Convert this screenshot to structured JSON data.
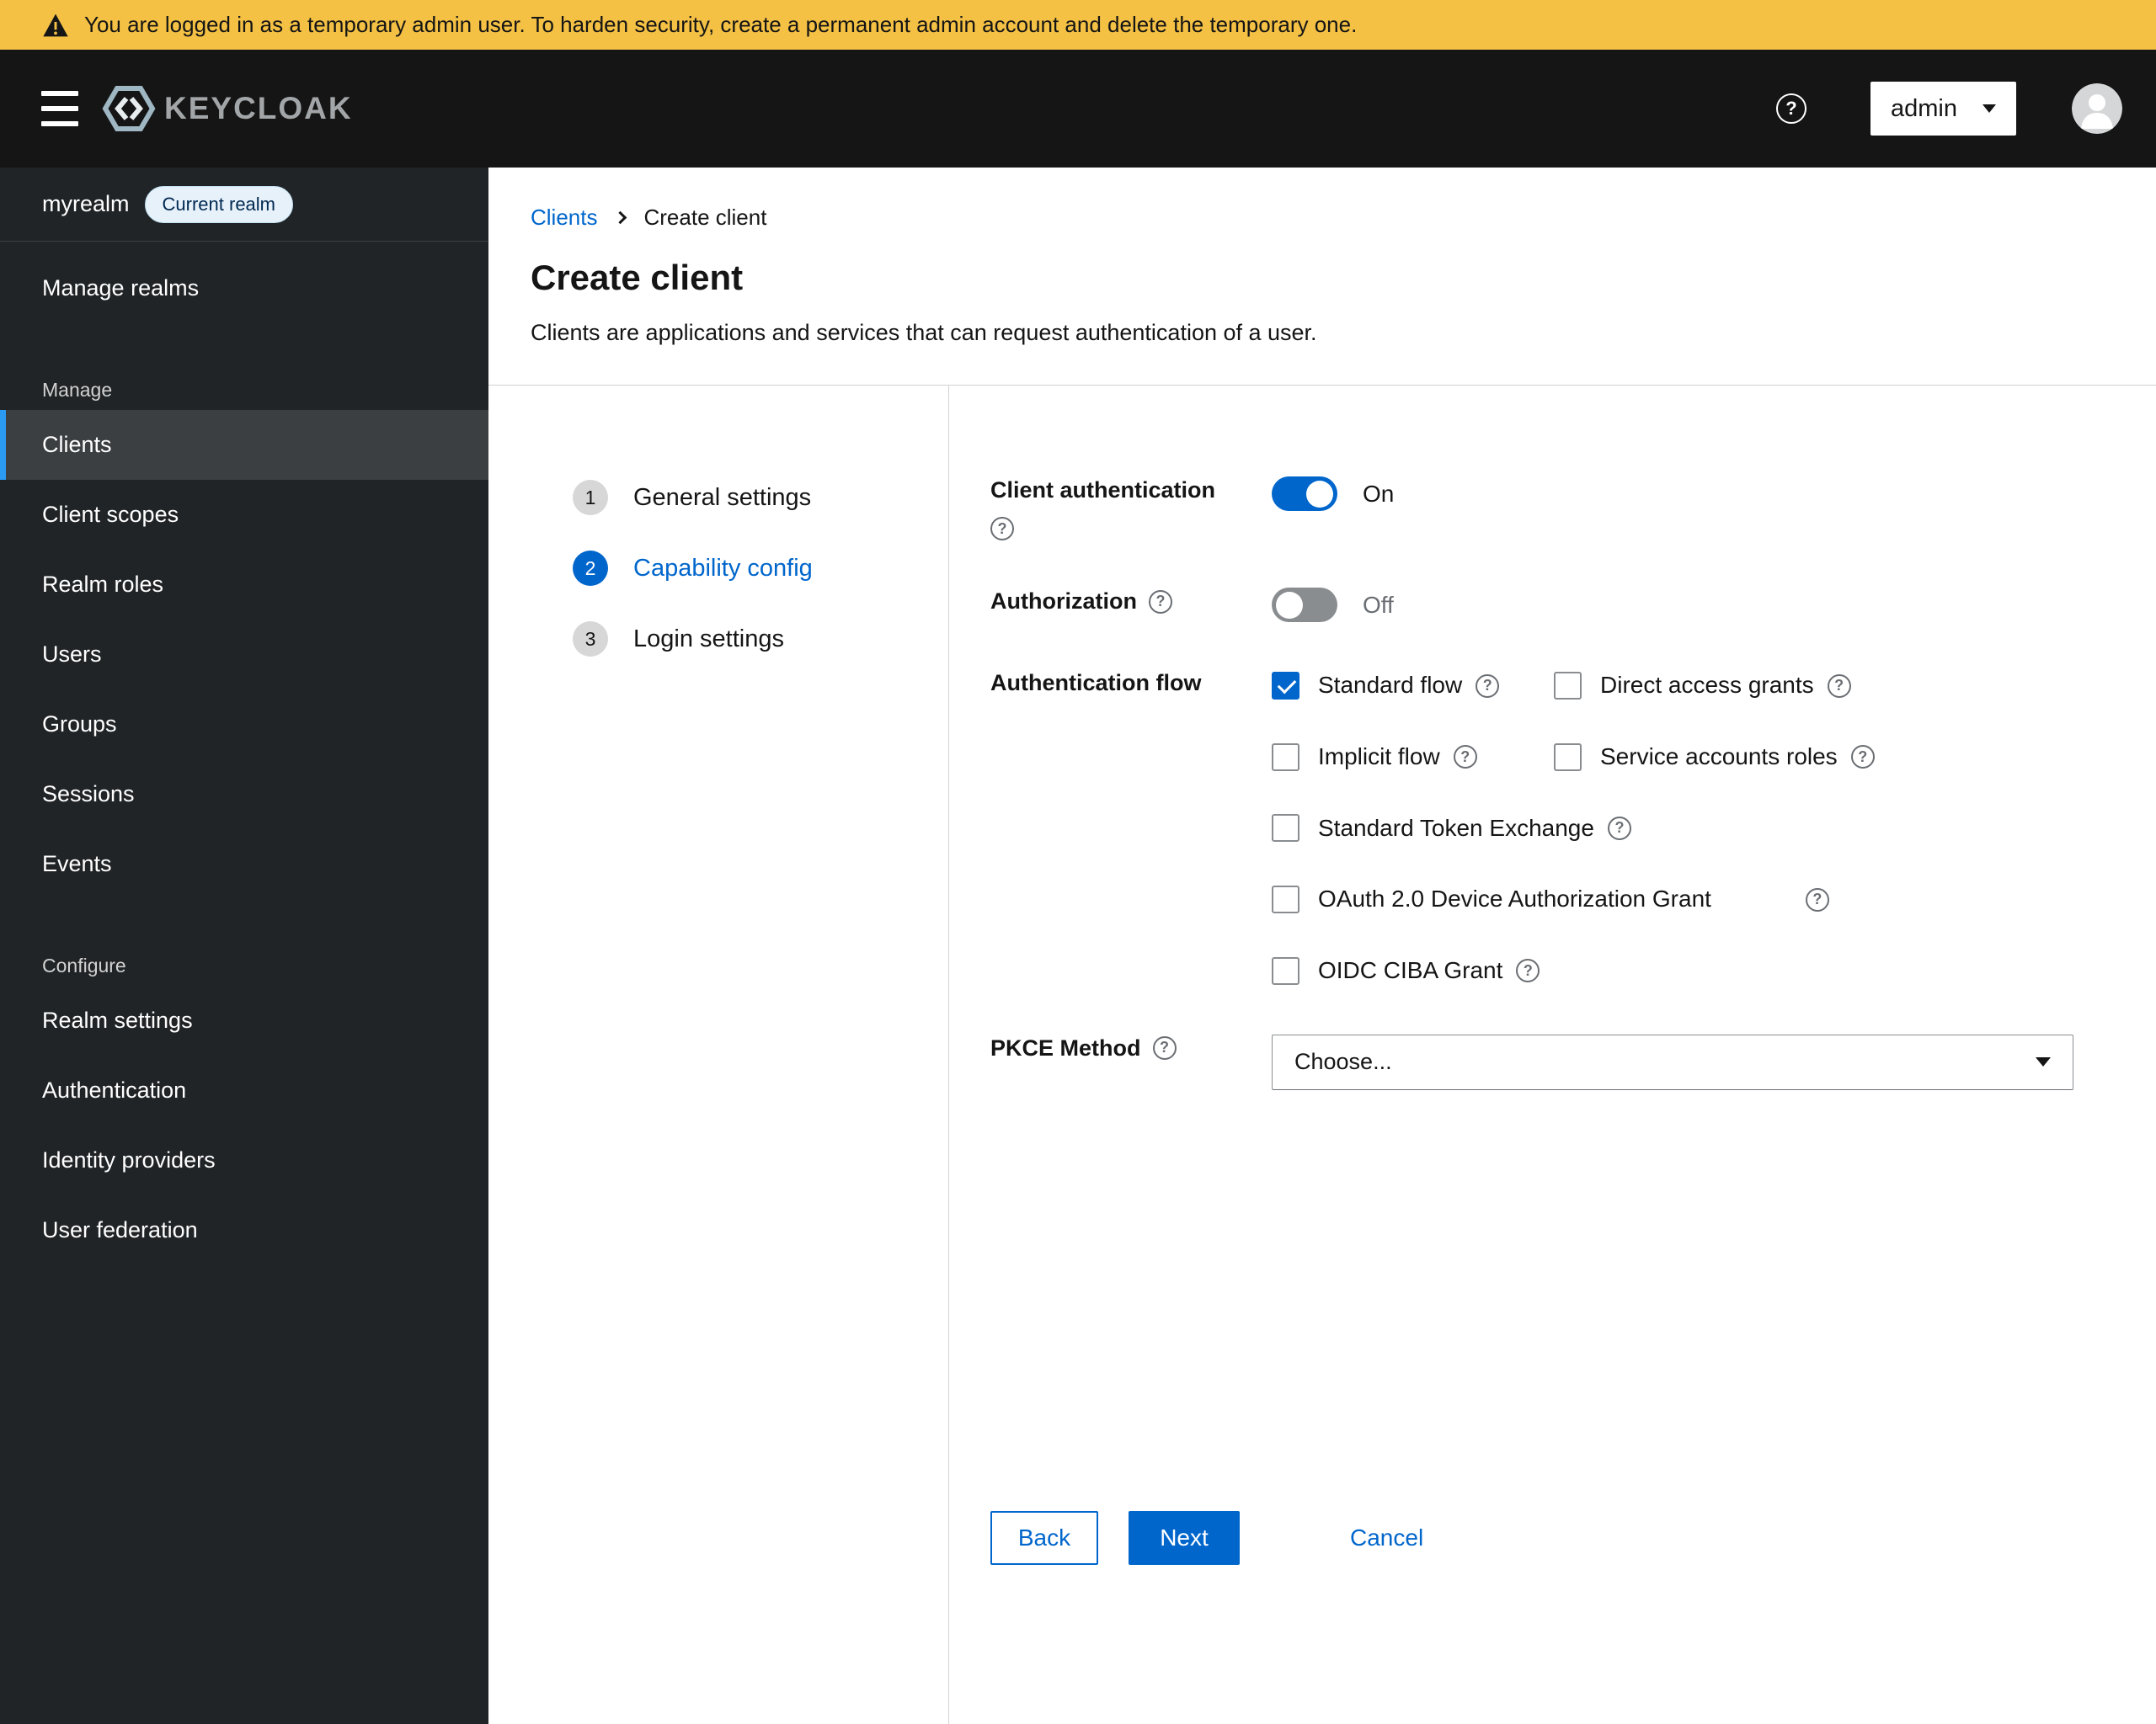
{
  "banner": {
    "text": "You are logged in as a temporary admin user. To harden security, create a permanent admin account and delete the temporary one."
  },
  "header": {
    "brand": "KEYCLOAK",
    "user": "admin"
  },
  "icons": {
    "warning": "triangle-exclamation",
    "menu": "hamburger",
    "help": "question-circle",
    "user_menu_caret": "chevron-down",
    "avatar": "person-silhouette",
    "breadcrumb_separator": "chevron-right",
    "select_caret": "caret-down"
  },
  "sidebar": {
    "realm": "myrealm",
    "realm_badge": "Current realm",
    "manage_realms": "Manage realms",
    "sections": [
      {
        "label": "Manage",
        "items": [
          {
            "label": "Clients",
            "active": true
          },
          {
            "label": "Client scopes",
            "active": false
          },
          {
            "label": "Realm roles",
            "active": false
          },
          {
            "label": "Users",
            "active": false
          },
          {
            "label": "Groups",
            "active": false
          },
          {
            "label": "Sessions",
            "active": false
          },
          {
            "label": "Events",
            "active": false
          }
        ]
      },
      {
        "label": "Configure",
        "items": [
          {
            "label": "Realm settings",
            "active": false
          },
          {
            "label": "Authentication",
            "active": false
          },
          {
            "label": "Identity providers",
            "active": false
          },
          {
            "label": "User federation",
            "active": false
          }
        ]
      }
    ]
  },
  "breadcrumb": {
    "items": [
      "Clients",
      "Create client"
    ]
  },
  "page": {
    "title": "Create client",
    "subtitle": "Clients are applications and services that can request authentication of a user."
  },
  "wizard": {
    "steps": [
      {
        "number": "1",
        "label": "General settings",
        "active": false
      },
      {
        "number": "2",
        "label": "Capability config",
        "active": true
      },
      {
        "number": "3",
        "label": "Login settings",
        "active": false
      }
    ]
  },
  "form": {
    "client_auth": {
      "label": "Client authentication",
      "state": "On",
      "enabled": true
    },
    "authorization": {
      "label": "Authorization",
      "state": "Off",
      "enabled": false
    },
    "auth_flow": {
      "label": "Authentication flow",
      "options": [
        {
          "label": "Standard flow",
          "checked": true
        },
        {
          "label": "Direct access grants",
          "checked": false
        },
        {
          "label": "Implicit flow",
          "checked": false
        },
        {
          "label": "Service accounts roles",
          "checked": false
        },
        {
          "label": "Standard Token Exchange",
          "checked": false
        },
        {
          "label": "OAuth 2.0 Device Authorization Grant",
          "checked": false
        },
        {
          "label": "OIDC CIBA Grant",
          "checked": false
        }
      ]
    },
    "pkce": {
      "label": "PKCE Method",
      "value": "Choose..."
    }
  },
  "actions": {
    "back": "Back",
    "next": "Next",
    "cancel": "Cancel"
  },
  "colors": {
    "accent": "#0066cc",
    "banner-bg": "#f4c145",
    "header-bg": "#151515",
    "sidebar-bg": "#212427",
    "sidebar-active-bg": "#3c3f42",
    "nav-indicator": "#2b9af3",
    "border": "#d2d2d2",
    "text": "#151515",
    "muted": "#6a6e73",
    "badge-bg": "#e7f1fa",
    "badge-text": "#002952",
    "toggle-off": "#8a8d90"
  }
}
